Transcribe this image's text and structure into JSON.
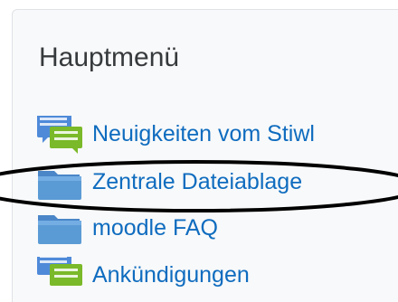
{
  "block": {
    "title": "Hauptmenü",
    "items": [
      {
        "label": "Neuigkeiten vom Stiwl",
        "icon": "forum-icon"
      },
      {
        "label": "Zentrale Dateiablage",
        "icon": "folder-icon"
      },
      {
        "label": "moodle FAQ",
        "icon": "folder-icon"
      },
      {
        "label": "Ankündigungen",
        "icon": "forum-icon"
      }
    ]
  },
  "colors": {
    "link": "#0f6cbf",
    "title": "#373a3c",
    "block_background": "#f8f9fa",
    "block_border": "#dfe2e6",
    "folder": "#5b9bd5",
    "forum_back": "#4f8ad9",
    "forum_front": "#7ab929",
    "annotation": "#000000"
  }
}
